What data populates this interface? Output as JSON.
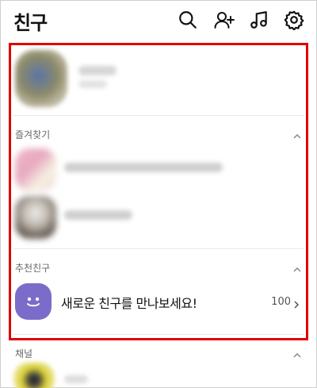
{
  "header": {
    "title": "친구",
    "icons": [
      "search-icon",
      "add-friend-icon",
      "music-icon",
      "settings-icon"
    ]
  },
  "sections": {
    "favorites": {
      "label": "즐겨찾기"
    },
    "recommended": {
      "label": "추천친구",
      "item_text": "새로운 친구를 만나보세요!",
      "count": "100"
    },
    "channels": {
      "label": "채널"
    }
  },
  "colors": {
    "highlight_border": "#e00000",
    "recommend_avatar": "#7c6cc9"
  }
}
